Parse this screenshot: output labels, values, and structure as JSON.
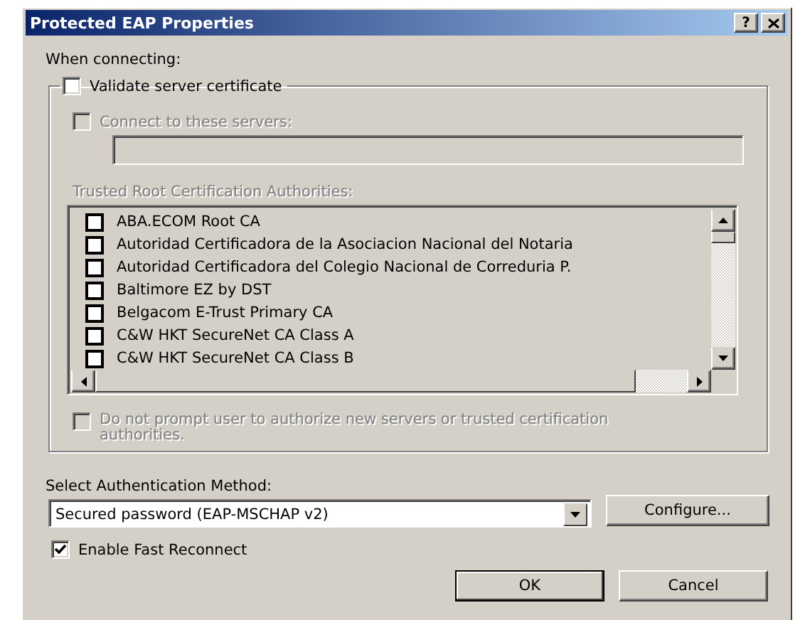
{
  "window": {
    "title": "Protected EAP Properties",
    "help_button": "?"
  },
  "when_connecting_label": "When connecting:",
  "validate_server_certificate": {
    "label": "Validate server certificate",
    "checked": false
  },
  "connect_to_servers": {
    "label": "Connect to these servers:",
    "checked": false,
    "disabled": true
  },
  "servers_field": {
    "disabled": true
  },
  "trusted_root_label": {
    "text": "Trusted Root Certification Authorities:",
    "disabled": true
  },
  "certificates": [
    {
      "name": "ABA.ECOM Root CA",
      "checked": false
    },
    {
      "name": "Autoridad Certificadora de la Asociacion Nacional del Notaria",
      "checked": false
    },
    {
      "name": "Autoridad Certificadora del Colegio Nacional de Correduria P.",
      "checked": false
    },
    {
      "name": "Baltimore EZ by DST",
      "checked": false
    },
    {
      "name": "Belgacom E-Trust Primary CA",
      "checked": false
    },
    {
      "name": "C&W HKT SecureNet CA Class A",
      "checked": false
    },
    {
      "name": "C&W HKT SecureNet CA Class B",
      "checked": false
    }
  ],
  "do_not_prompt": {
    "label": "Do not prompt user to authorize new servers or trusted certification authorities.",
    "checked": false,
    "disabled": true
  },
  "authentication_method_label": "Select Authentication Method:",
  "authentication_method": {
    "value": "Secured password (EAP-MSCHAP v2)"
  },
  "configure_button": "Configure...",
  "enable_fast_reconnect": {
    "label": "Enable Fast Reconnect",
    "checked": true
  },
  "buttons": [
    "OK",
    "Cancel"
  ]
}
